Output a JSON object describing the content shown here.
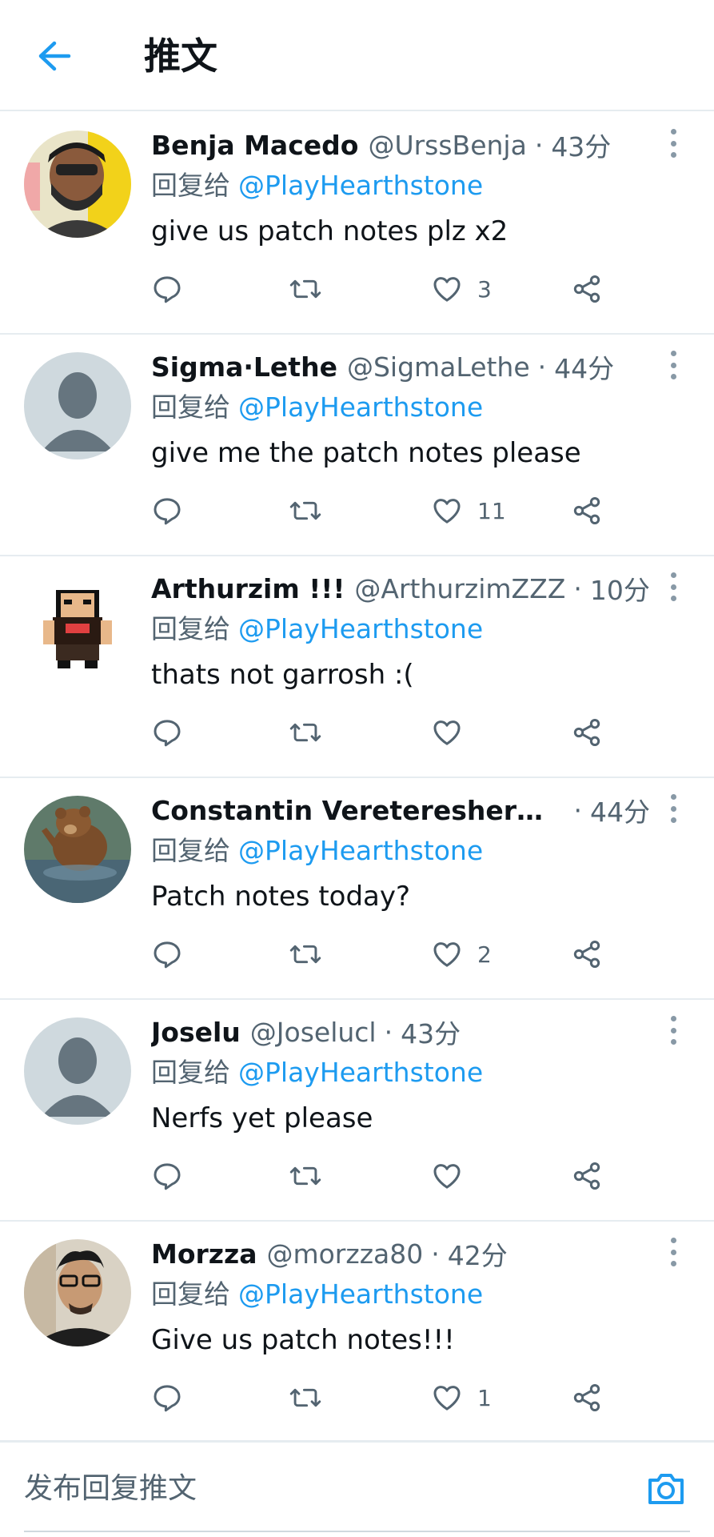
{
  "header": {
    "title": "推文",
    "back_icon": "arrow-left-icon"
  },
  "colors": {
    "accent": "#1d9bf0",
    "text": "#0f1419",
    "secondary": "#536471",
    "divider": "#e6ecf0"
  },
  "tweets": [
    {
      "name": "Benja Macedo",
      "handle": "@UrssBenja",
      "time": "43分",
      "reply_label": "回复给",
      "reply_to": "@PlayHearthstone",
      "text": "give us patch notes plz x2",
      "likes": "3"
    },
    {
      "name": "Sigma·Lethe",
      "handle": "@SigmaLethe",
      "time": "44分",
      "reply_label": "回复给",
      "reply_to": "@PlayHearthstone",
      "text": "give me the patch notes please",
      "likes": "11"
    },
    {
      "name": "Arthurzim !!!",
      "handle": "@ArthurzimZZZ",
      "time": "10分",
      "reply_label": "回复给",
      "reply_to": "@PlayHearthstone",
      "text": "thats not garrosh :(",
      "likes": ""
    },
    {
      "name": "Constantin Veretereshere…",
      "handle": "",
      "time": "44分",
      "reply_label": "回复给",
      "reply_to": "@PlayHearthstone",
      "text": "Patch notes today?",
      "likes": "2"
    },
    {
      "name": "Joselu",
      "handle": "@Joselucl",
      "time": "43分",
      "reply_label": "回复给",
      "reply_to": "@PlayHearthstone",
      "text": "Nerfs yet please",
      "likes": ""
    },
    {
      "name": "Morzza",
      "handle": "@morzza80",
      "time": "42分",
      "reply_label": "回复给",
      "reply_to": "@PlayHearthstone",
      "text": "Give us patch notes!!!",
      "likes": "1"
    }
  ],
  "separator": "·",
  "composer": {
    "placeholder": "发布回复推文",
    "camera_icon": "camera-icon"
  }
}
